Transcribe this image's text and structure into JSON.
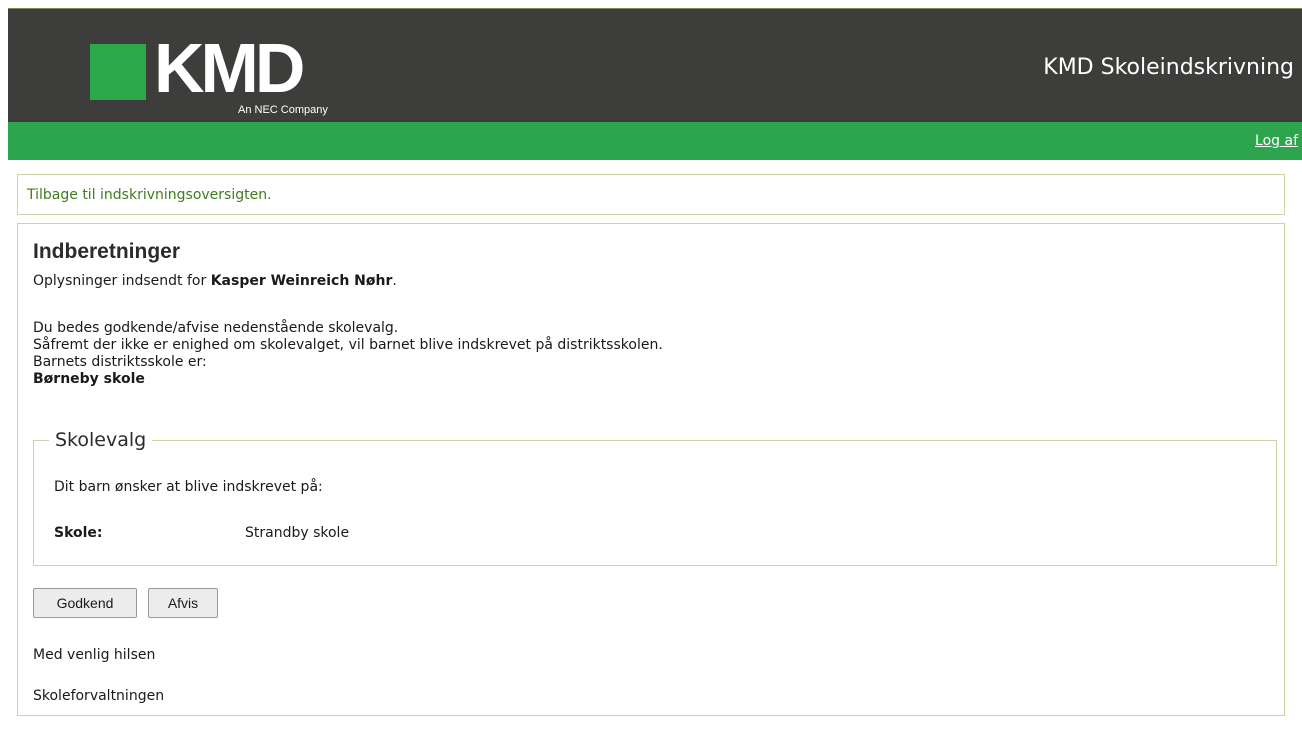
{
  "header": {
    "logo_text": "KMD",
    "logo_subtitle": "An NEC Company",
    "app_title": "KMD Skoleindskrivning"
  },
  "nav": {
    "logout_label": "Log af"
  },
  "back_link": "Tilbage til indskrivningsoversigten.",
  "main": {
    "title": "Indberetninger",
    "intro_prefix": "Oplysninger indsendt for ",
    "child_name": "Kasper Weinreich Nøhr",
    "intro_suffix": ".",
    "instruction_1": "Du bedes godkende/afvise nedenstående skolevalg.",
    "instruction_2": "Såfremt der ikke er enighed om skolevalget, vil barnet blive indskrevet på distriktsskolen.",
    "district_label": "Barnets distriktsskole er:",
    "district_school": "Børneby skole"
  },
  "school_choice": {
    "legend": "Skolevalg",
    "wish_text": "Dit barn ønsker at blive indskrevet på:",
    "school_label": "Skole:",
    "school_value": "Strandby skole"
  },
  "actions": {
    "approve_label": "Godkend",
    "reject_label": "Afvis"
  },
  "footer": {
    "greeting": "Med venlig hilsen",
    "sender": "Skoleforvaltningen"
  },
  "colors": {
    "header_bg": "#3d3d3b",
    "brand_green": "#2da44e",
    "link_green": "#3e7d1f",
    "border_green": "#c6d8a6"
  }
}
